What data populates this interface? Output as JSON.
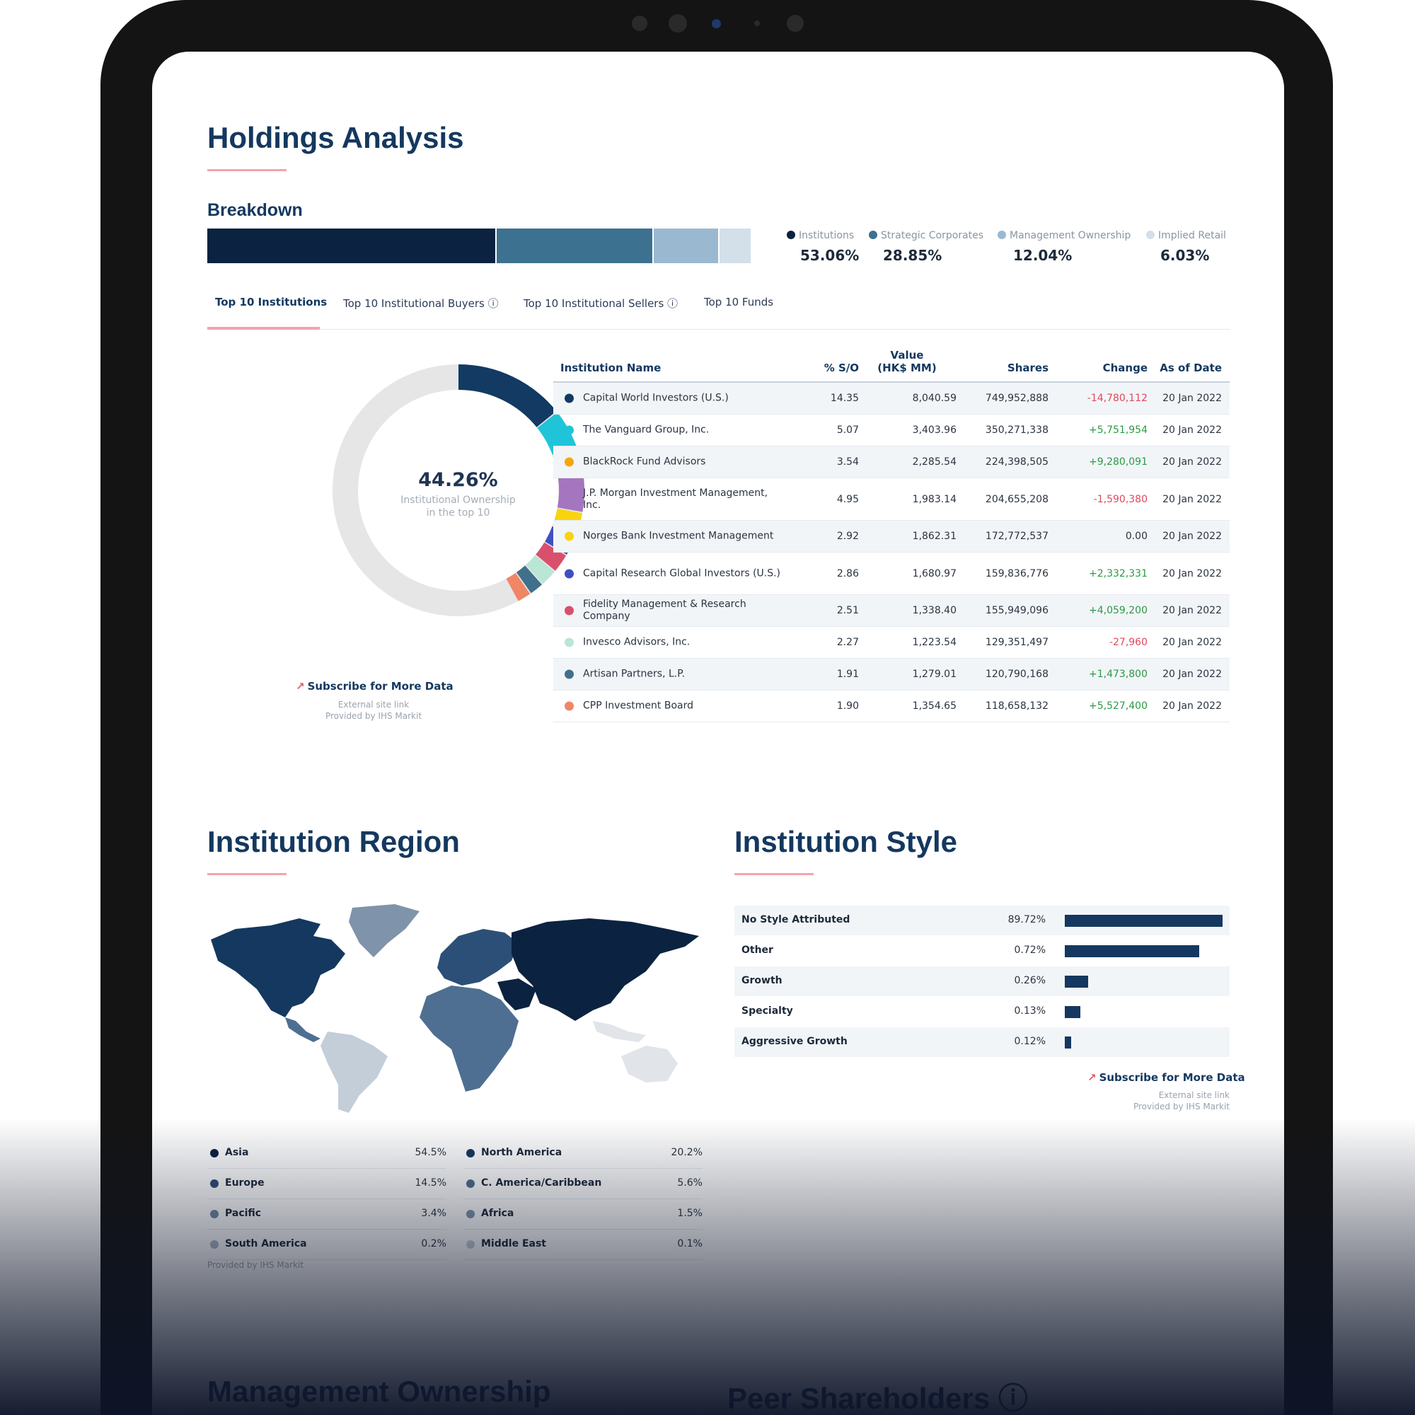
{
  "page_title": "Holdings Analysis",
  "breakdown": {
    "title": "Breakdown",
    "segments": [
      {
        "label": "Institutions",
        "value": "53.06%",
        "fraction": 0.5306,
        "color": "#0b2240"
      },
      {
        "label": "Strategic Corporates",
        "value": "28.85%",
        "fraction": 0.2885,
        "color": "#3d7190"
      },
      {
        "label": "Management Ownership",
        "value": "12.04%",
        "fraction": 0.1204,
        "color": "#9ab8d0"
      },
      {
        "label": "Implied Retail",
        "value": "6.03%",
        "fraction": 0.0603,
        "color": "#d3dfe9"
      }
    ]
  },
  "tabs": [
    {
      "label": "Top 10 Institutions",
      "active": true
    },
    {
      "label": "Top 10 Institutional Buyers ⓘ",
      "active": false
    },
    {
      "label": "Top 10 Institutional Sellers ⓘ",
      "active": false
    },
    {
      "label": "Top 10 Funds",
      "active": false
    }
  ],
  "donut": {
    "center_value": "44.26%",
    "center_label_1": "Institutional Ownership",
    "center_label_2": "in the top 10",
    "remainder_color": "#e6e6e6"
  },
  "subscribe": {
    "label": "Subscribe for More Data",
    "note_1": "External site link",
    "note_2": "Provided by IHS Markit"
  },
  "table": {
    "headers": {
      "name": "Institution Name",
      "pct": "% S/O",
      "value_1": "Value",
      "value_2": "(HK$ MM)",
      "shares": "Shares",
      "change": "Change",
      "date": "As of Date"
    },
    "rows": [
      {
        "name": "Capital World Investors (U.S.)",
        "pct": "14.35",
        "pct_num": 14.35,
        "value": "8,040.59",
        "shares": "749,952,888",
        "change": "-14,780,112",
        "dir": "neg",
        "date": "20 Jan 2022",
        "color": "#123a63"
      },
      {
        "name": "The Vanguard Group, Inc.",
        "pct": "5.07",
        "pct_num": 5.07,
        "value": "3,403.96",
        "shares": "350,271,338",
        "change": "+5,751,954",
        "dir": "pos",
        "date": "20 Jan 2022",
        "color": "#20c4d8"
      },
      {
        "name": "BlackRock Fund Advisors",
        "pct": "3.54",
        "pct_num": 3.54,
        "value": "2,285.54",
        "shares": "224,398,505",
        "change": "+9,280,091",
        "dir": "pos",
        "date": "20 Jan 2022",
        "color": "#f5a60f"
      },
      {
        "name": "J.P. Morgan Investment Management, Inc.",
        "pct": "4.95",
        "pct_num": 4.95,
        "value": "1,983.14",
        "shares": "204,655,208",
        "change": "-1,590,380",
        "dir": "neg",
        "date": "20 Jan 2022",
        "color": "#a576bf"
      },
      {
        "name": "Norges Bank Investment Management",
        "pct": "2.92",
        "pct_num": 2.92,
        "value": "1,862.31",
        "shares": "172,772,537",
        "change": "0.00",
        "dir": "neu",
        "date": "20 Jan 2022",
        "color": "#f8d410"
      },
      {
        "name": "Capital Research Global Investors (U.S.)",
        "pct": "2.86",
        "pct_num": 2.86,
        "value": "1,680.97",
        "shares": "159,836,776",
        "change": "+2,332,331",
        "dir": "pos",
        "date": "20 Jan 2022",
        "color": "#3f4fc2"
      },
      {
        "name": "Fidelity Management & Research Company",
        "pct": "2.51",
        "pct_num": 2.51,
        "value": "1,338.40",
        "shares": "155,949,096",
        "change": "+4,059,200",
        "dir": "pos",
        "date": "20 Jan 2022",
        "color": "#d9506d"
      },
      {
        "name": "Invesco Advisors, Inc.",
        "pct": "2.27",
        "pct_num": 2.27,
        "value": "1,223.54",
        "shares": "129,351,497",
        "change": "-27,960",
        "dir": "neg",
        "date": "20 Jan 2022",
        "color": "#b9e6d5"
      },
      {
        "name": "Artisan Partners, L.P.",
        "pct": "1.91",
        "pct_num": 1.91,
        "value": "1,279.01",
        "shares": "120,790,168",
        "change": "+1,473,800",
        "dir": "pos",
        "date": "20 Jan 2022",
        "color": "#40708c"
      },
      {
        "name": "CPP Investment Board",
        "pct": "1.90",
        "pct_num": 1.9,
        "value": "1,354.65",
        "shares": "118,658,132",
        "change": "+5,527,400",
        "dir": "pos",
        "date": "20 Jan 2022",
        "color": "#f08666"
      }
    ]
  },
  "region": {
    "title": "Institution Region",
    "items": [
      {
        "label": "Asia",
        "value": "54.5%",
        "color": "#0b2240"
      },
      {
        "label": "North America",
        "value": "20.2%",
        "color": "#14385f"
      },
      {
        "label": "Europe",
        "value": "14.5%",
        "color": "#2c4f78"
      },
      {
        "label": "C. America/Caribbean",
        "value": "5.6%",
        "color": "#4e6f91"
      },
      {
        "label": "Pacific",
        "value": "3.4%",
        "color": "#6e88a6"
      },
      {
        "label": "Africa",
        "value": "1.5%",
        "color": "#7f93aa"
      },
      {
        "label": "South America",
        "value": "0.2%",
        "color": "#a9b8c8"
      },
      {
        "label": "Middle East",
        "value": "0.1%",
        "color": "#c4ced9"
      }
    ],
    "note": "Provided by IHS Markit"
  },
  "style": {
    "title": "Institution Style",
    "items": [
      {
        "label": "No Style Attributed",
        "value": "89.72%",
        "bar_fraction": 1.0
      },
      {
        "label": "Other",
        "value": "0.72%",
        "bar_fraction": 0.85
      },
      {
        "label": "Growth",
        "value": "0.26%",
        "bar_fraction": 0.15
      },
      {
        "label": "Specialty",
        "value": "0.13%",
        "bar_fraction": 0.1
      },
      {
        "label": "Aggressive Growth",
        "value": "0.12%",
        "bar_fraction": 0.04
      }
    ]
  },
  "bottom_sections": {
    "left": "Management Ownership",
    "right": "Peer Shareholders ⓘ"
  }
}
